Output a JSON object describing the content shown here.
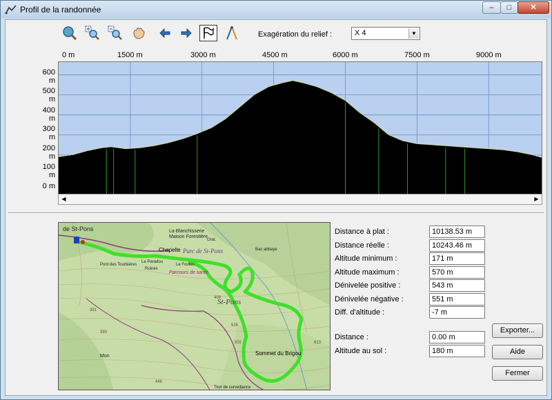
{
  "window": {
    "title": "Profil de la randonnée",
    "minimize_label": "–",
    "maximize_label": "□",
    "close_label": "✕"
  },
  "toolbar": {
    "icons": [
      "zoom-extent-icon",
      "zoom-in-icon",
      "zoom-out-icon",
      "pan-hand-icon",
      "arrow-left-icon",
      "arrow-right-icon",
      "flag-profile-icon",
      "compass-measure-icon"
    ],
    "exaggeration_label": "Exagération du relief :",
    "exaggeration_value": "X 4"
  },
  "profile": {
    "x_ticks": [
      "0 m",
      "1500 m",
      "3000 m",
      "4500 m",
      "6000 m",
      "7500 m",
      "9000 m"
    ],
    "y_ticks": [
      "600 m",
      "500 m",
      "400 m",
      "300 m",
      "200 m",
      "100 m",
      "0 m"
    ],
    "x_range_m": [
      0,
      10138
    ],
    "y_range_m": [
      0,
      650
    ],
    "elevation_profile_m": [
      [
        0,
        190
      ],
      [
        300,
        200
      ],
      [
        600,
        220
      ],
      [
        900,
        235
      ],
      [
        1100,
        240
      ],
      [
        1400,
        230
      ],
      [
        1700,
        235
      ],
      [
        2000,
        245
      ],
      [
        2300,
        260
      ],
      [
        2600,
        280
      ],
      [
        2900,
        305
      ],
      [
        3200,
        335
      ],
      [
        3500,
        380
      ],
      [
        3800,
        440
      ],
      [
        4100,
        500
      ],
      [
        4400,
        540
      ],
      [
        4700,
        560
      ],
      [
        4900,
        570
      ],
      [
        5100,
        560
      ],
      [
        5400,
        540
      ],
      [
        5700,
        510
      ],
      [
        6000,
        470
      ],
      [
        6300,
        410
      ],
      [
        6600,
        360
      ],
      [
        6900,
        300
      ],
      [
        7200,
        270
      ],
      [
        7500,
        255
      ],
      [
        7800,
        250
      ],
      [
        8100,
        245
      ],
      [
        8400,
        240
      ],
      [
        8700,
        235
      ],
      [
        9000,
        230
      ],
      [
        9300,
        225
      ],
      [
        9600,
        215
      ],
      [
        9900,
        200
      ],
      [
        10138,
        185
      ]
    ],
    "waypoint_distances_m": [
      1000,
      1150,
      1600,
      2900,
      6000,
      6700,
      7300,
      8100,
      8500
    ],
    "colors": {
      "sky": "#b9d0f0",
      "terrain": "#000000",
      "grid": "#6b8fc7",
      "waypoint_line": "#2e9a2e",
      "ridge": "#e8e23c"
    }
  },
  "map": {
    "labels": [
      "de St-Pons",
      "La Blanchisserie",
      "Maison Forestière",
      "Chapelle",
      "Parc de St-Pons",
      "Le Foulon",
      "Ruines",
      "Pont des Tourbières",
      "Le Paradou",
      "Parcours de santé",
      "St-Pons",
      "Sommet du Brigou",
      "Tour de surveillance",
      "Mon",
      "Orat.",
      "Bac abbaye",
      "381",
      "393",
      "408",
      "446",
      "502",
      "526",
      "613"
    ],
    "colors": {
      "terrain": "#c8dca8",
      "forest": "#a9c98a",
      "track": "#3fe02a",
      "road": "#8b3a7a",
      "contour": "#b89a6a"
    }
  },
  "stats": [
    {
      "label": "Distance à plat :",
      "value": "10138.53 m"
    },
    {
      "label": "Distance réelle :",
      "value": "10243.46 m"
    },
    {
      "label": "Altitude minimum :",
      "value": "171 m"
    },
    {
      "label": "Altitude maximum :",
      "value": "570 m"
    },
    {
      "label": "Dénivelée positive :",
      "value": "543 m"
    },
    {
      "label": "Dénivelée négative :",
      "value": "551 m"
    },
    {
      "label": "Diff. d'altitude :",
      "value": "-7 m"
    }
  ],
  "cursor": [
    {
      "label": "Distance :",
      "value": "0.00 m"
    },
    {
      "label": "Altitude au sol :",
      "value": "180 m"
    }
  ],
  "buttons": {
    "export": "Exporter...",
    "help": "Aide",
    "close": "Fermer"
  }
}
